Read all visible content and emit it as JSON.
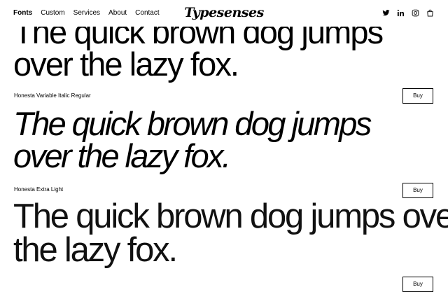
{
  "nav": {
    "items": [
      "Fonts",
      "Custom",
      "Services",
      "About",
      "Contact"
    ],
    "active": "Fonts"
  },
  "logo": "Typesenses",
  "social_icons": [
    "twitter-icon",
    "linkedin-icon",
    "instagram-icon",
    "bag-icon"
  ],
  "samples": [
    {
      "name": "",
      "lines": [
        "The quick brown dog jumps",
        "over the lazy fox."
      ],
      "buy_label": "Buy"
    },
    {
      "name": "Honesta Variable Italic Regular",
      "lines": [
        "The quick brown dog jumps",
        "over the lazy fox."
      ],
      "buy_label": "Buy"
    },
    {
      "name": "Honesta Extra Light",
      "lines": [
        "The quick brown dog jumps over",
        "the lazy fox."
      ],
      "buy_label": "Buy"
    }
  ],
  "colors": {
    "text": "#000000",
    "background": "#ffffff"
  }
}
